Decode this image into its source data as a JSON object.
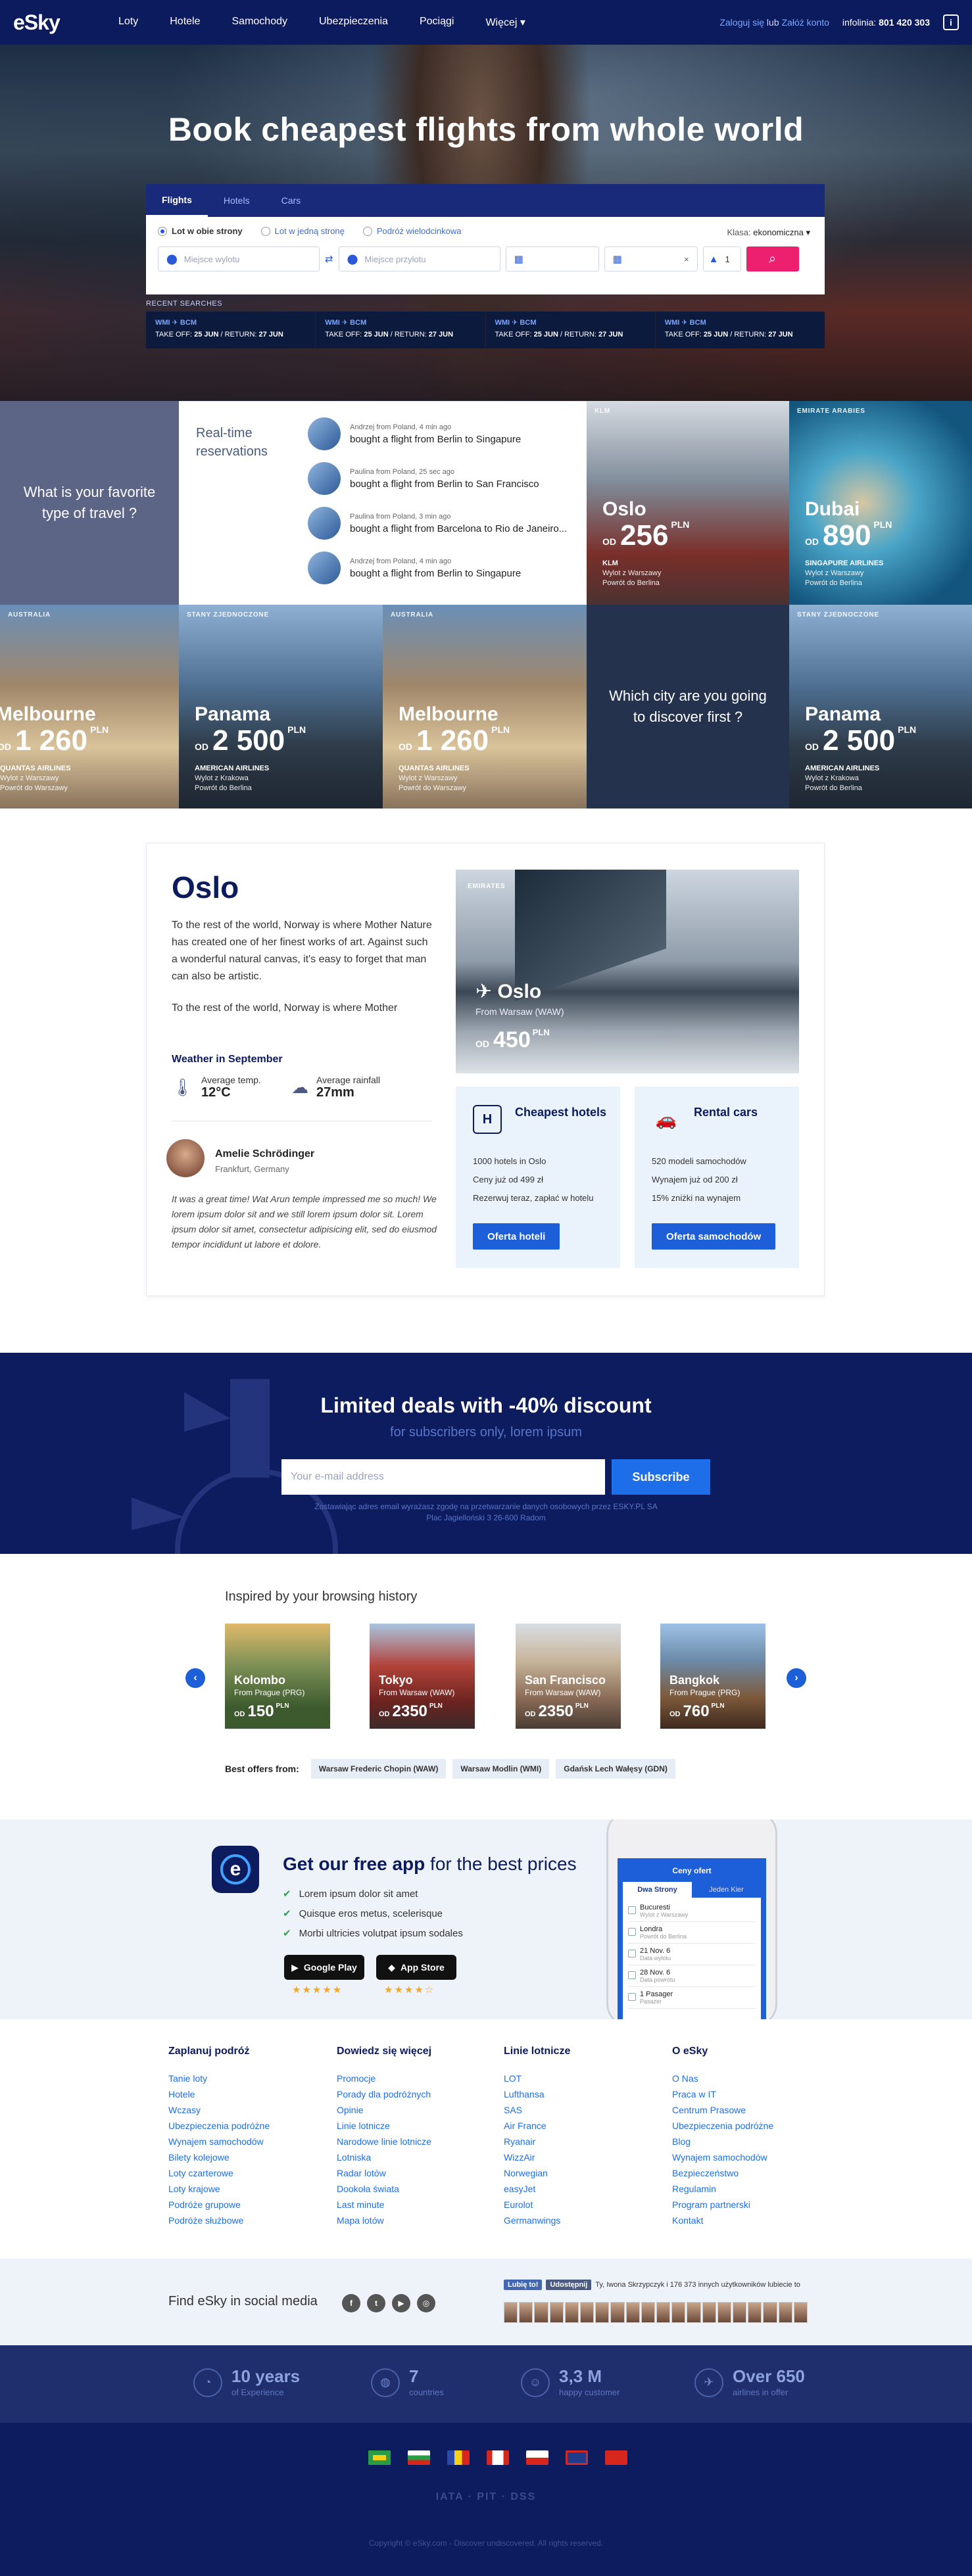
{
  "header": {
    "logo": "eSky",
    "nav": [
      "Loty",
      "Hotele",
      "Samochody",
      "Ubezpieczenia",
      "Pociągi",
      "Więcej ▾"
    ],
    "login": "Zaloguj się",
    "or": "lub",
    "register": "Załóż konto",
    "infoline_label": "infolinia:",
    "infoline_number": "801 420 303",
    "info_icon": "i"
  },
  "hero": {
    "title": "Book cheapest flights from whole world",
    "tabs": [
      "Flights",
      "Hotels",
      "Cars"
    ],
    "trip_types": [
      "Lot w obie strony",
      "Lot w jedną stronę",
      "Podróż wielodcinkowa"
    ],
    "class_label": "Klasa:",
    "class_value": "ekonomiczna ▾",
    "from_placeholder": "Miejsce wylotu",
    "to_placeholder": "Miejsce przylotu",
    "passengers": "1",
    "recent_label": "RECENT SEARCHES",
    "recent": [
      {
        "route": "WMI ✈ BCM",
        "takeoff": "25 JUN",
        "return": "27 JUN"
      },
      {
        "route": "WMI ✈ BCM",
        "takeoff": "25 JUN",
        "return": "27 JUN"
      },
      {
        "route": "WMI ✈ BCM",
        "takeoff": "25 JUN",
        "return": "27 JUN"
      },
      {
        "route": "WMI ✈ BCM",
        "takeoff": "25 JUN",
        "return": "27 JUN"
      }
    ],
    "takeoff_label": "TAKE OFF:",
    "return_label": "RETURN:"
  },
  "tiles": {
    "travel_type_q": "What is your favorite type of travel ?",
    "city_q": "Which city are you going to discover first ?",
    "realtime_title": "Real-time reservations",
    "realtime": [
      {
        "meta": "Andrzej from Poland, 4 min ago",
        "text": "bought a flight from Berlin to Singapure"
      },
      {
        "meta": "Paulina from Poland, 25 sec ago",
        "text": "bought a flight from Berlin to San Francisco"
      },
      {
        "meta": "Paulina from Poland, 3 min ago",
        "text": "bought a flight from Barcelona to Rio de Janeiro..."
      },
      {
        "meta": "Andrzej from Poland, 4 min ago",
        "text": "bought a flight from Berlin to Singapure"
      }
    ],
    "deals": [
      {
        "tag": "KLM",
        "city": "Oslo",
        "od": "OD",
        "price": "256",
        "cur": "PLN",
        "airline": "KLM",
        "l1": "Wylot z Warszawy",
        "l2": "Powrót do Berlina"
      },
      {
        "tag": "EMIRATE ARABIES",
        "city": "Dubai",
        "od": "OD",
        "price": "890",
        "cur": "PLN",
        "airline": "SINGAPURE AIRLINES",
        "l1": "Wylot z Warszawy",
        "l2": "Powrót do Berlina"
      },
      {
        "tag": "AUSTRALIA",
        "city": "Melbourne",
        "od": "OD",
        "price": "1 260",
        "cur": "PLN",
        "airline": "QUANTAS AIRLINES",
        "l1": "Wylot z Warszawy",
        "l2": "Powrót do Warszawy"
      },
      {
        "tag": "STANY ZJEDNOCZONE",
        "city": "Panama",
        "od": "OD",
        "price": "2 500",
        "cur": "PLN",
        "airline": "AMERICAN AIRLINES",
        "l1": "Wylot z Krakowa",
        "l2": "Powrót do Berlina"
      },
      {
        "tag": "AUSTRALIA",
        "city": "Melbourne",
        "od": "OD",
        "price": "1 260",
        "cur": "PLN",
        "airline": "QUANTAS AIRLINES",
        "l1": "Wylot z Warszawy",
        "l2": "Powrót do Warszawy"
      },
      {
        "tag": "STANY ZJEDNOCZONE",
        "city": "Panama",
        "od": "OD",
        "price": "2 500",
        "cur": "PLN",
        "airline": "AMERICAN AIRLINES",
        "l1": "Wylot z Krakowa",
        "l2": "Powrót do Berlina"
      }
    ]
  },
  "oslo": {
    "title": "Oslo",
    "p1": "To the rest of the world, Norway is where Mother Nature has created one of her finest works of art. Against such a wonderful natural canvas, it's easy to forget that man can also be artistic.",
    "p2": "To the rest of the world, Norway is where Mother",
    "weather_title": "Weather in September",
    "temp_label": "Average temp.",
    "temp_value": "12°C",
    "rain_label": "Average rainfall",
    "rain_value": "27mm",
    "reviewer": "Amelie Schrödinger",
    "reviewer_city": "Frankfurt, Germany",
    "quote": "It was a great time! Wat Arun temple impressed me so much! We lorem ipsum dolor sit and we still lorem ipsum dolor sit. Lorem ipsum dolor sit amet, consectetur adipisicing elit, sed do eiusmod tempor incididunt ut labore et dolore.",
    "img_tag": "EMIRATES",
    "img_city": "✈ Oslo",
    "img_from": "From Warsaw (WAW)",
    "img_od": "OD",
    "img_price": "450",
    "img_cur": "PLN",
    "hotels_title": "Cheapest hotels",
    "hotels_lines": [
      "1000 hotels in Oslo",
      "Ceny już od 499 zł",
      "Rezerwuj teraz, zapłać w hotelu"
    ],
    "hotels_btn": "Oferta hoteli",
    "cars_title": "Rental cars",
    "cars_lines": [
      "520 modeli samochodów",
      "Wynajem już od 200 zł",
      "15% zniżki na wynajem"
    ],
    "cars_btn": "Oferta samochodów",
    "hotels_icon": "H",
    "cars_icon": "🚗"
  },
  "deals": {
    "title": "Limited deals with -40% discount",
    "subtitle": "for subscribers only, lorem ipsum",
    "email_placeholder": "Your e-mail address",
    "button": "Subscribe",
    "fine1": "Zostawiając adres email wyrażasz zgodę na przetwarzanie danych osobowych przez ESKY.PL SA",
    "fine2": "Plac Jagielloński 3 26-600 Radom"
  },
  "inspired": {
    "title": "Inspired by your browsing history",
    "cards": [
      {
        "city": "Kolombo",
        "from": "From Prague (PRG)",
        "od": "OD",
        "price": "150",
        "cur": "PLN"
      },
      {
        "city": "Tokyo",
        "from": "From Warsaw (WAW)",
        "od": "OD",
        "price": "2350",
        "cur": "PLN"
      },
      {
        "city": "San Francisco",
        "from": "From Warsaw (WAW)",
        "od": "OD",
        "price": "2350",
        "cur": "PLN"
      },
      {
        "city": "Bangkok",
        "from": "From Prague (PRG)",
        "od": "OD",
        "price": "760",
        "cur": "PLN"
      }
    ],
    "best_label": "Best offers from:",
    "airports": [
      "Warsaw Frederic Chopin (WAW)",
      "Warsaw Modlin (WMI)",
      "Gdańsk Lech Wałęsy (GDN)"
    ]
  },
  "app": {
    "title_bold": "Get our free app",
    "title_rest": "for the best prices",
    "features": [
      "Lorem ipsum dolor sit amet",
      "Quisque eros metus, scelerisque",
      "Morbi ultricies volutpat ipsum sodales"
    ],
    "google": "Google Play",
    "apple": "App Store",
    "google_stars": "★★★★★",
    "apple_stars": "★★★★☆",
    "phone_title": "Ceny ofert",
    "phone_tabs": [
      "Dwa Strony",
      "Jeden Kier"
    ],
    "phone_rows": [
      {
        "a": "Bucuresti",
        "b": "Wylot z Warszawy"
      },
      {
        "a": "Londra",
        "b": "Powrót do Berlina"
      },
      {
        "a": "21 Nov. 6",
        "b": "Data wylotu"
      },
      {
        "a": "28 Nov. 6",
        "b": "Data powrotu"
      },
      {
        "a": "1 Pasager",
        "b": "Pasażer"
      }
    ]
  },
  "footer": {
    "cols": [
      {
        "title": "Zaplanuj podróż",
        "links": [
          "Tanie loty",
          "Hotele",
          "Wczasy",
          "Ubezpieczenia podróżne",
          "Wynajem samochodów",
          "Bilety kolejowe",
          "Loty czarterowe",
          "Loty krajowe",
          "Podróże grupowe",
          "Podróże służbowe"
        ]
      },
      {
        "title": "Dowiedz się więcej",
        "links": [
          "Promocje",
          "Porady dla podróżnych",
          "Opinie",
          "Linie lotnicze",
          "Narodowe linie lotnicze",
          "Lotniska",
          "Radar lotów",
          "Dookoła świata",
          "Last minute",
          "Mapa lotów"
        ]
      },
      {
        "title": "Linie lotnicze",
        "links": [
          "LOT",
          "Lufthansa",
          "SAS",
          "Air France",
          "Ryanair",
          "WizzAir",
          "Norwegian",
          "easyJet",
          "Eurolot",
          "Germanwings"
        ]
      },
      {
        "title": "O eSky",
        "links": [
          "O Nas",
          "Praca w IT",
          "Centrum Prasowe",
          "Ubezpieczenia podróżne",
          "Blog",
          "Wynajem samochodów",
          "Bezpieczeństwo",
          "Regulamin",
          "Program partnerski",
          "Kontakt"
        ]
      }
    ],
    "social_title": "Find eSky in social media",
    "social_icons": [
      "f",
      "t",
      "▶",
      "◎"
    ],
    "fb_like": "Lubię to!",
    "fb_share": "Udostępnij",
    "fb_text": "Ty, Iwona Skrzypczyk i 176 373 innych użytkowników lubiecie to",
    "stats": [
      {
        "value": "10 years",
        "label": "of Experience",
        "icon": "◔"
      },
      {
        "value": "7",
        "label": "countries",
        "icon": "◍"
      },
      {
        "value": "3,3 M",
        "label": "happy customer",
        "icon": "☺"
      },
      {
        "value": "Over 650",
        "label": "airlines in offer",
        "icon": "✈"
      }
    ],
    "partners": "IATA · PIT · DSS",
    "copyright": "Copyright © eSky.com - Discover undiscovered. All rights reserved."
  },
  "colors": {
    "navy": "#0c1a5e",
    "accent": "#ed1f6f",
    "link": "#1d6ee8",
    "button": "#1d5fd8"
  }
}
